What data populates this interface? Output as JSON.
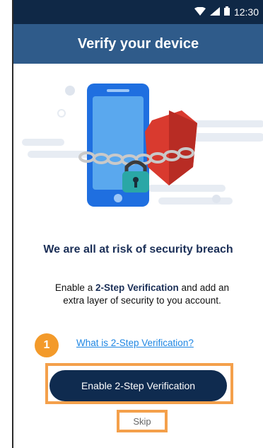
{
  "status_bar": {
    "time": "12:30",
    "icons": [
      "wifi-icon",
      "signal-icon",
      "battery-icon"
    ]
  },
  "app_bar": {
    "title": "Verify your device"
  },
  "illustration": {
    "name": "phone-chain-lock-shield"
  },
  "content": {
    "headline": "We are all at risk of security breach",
    "desc_prefix": "Enable a ",
    "desc_bold": "2-Step Verification",
    "desc_suffix": " and add an extra layer of security to you account."
  },
  "help_link": {
    "label": "What is 2-Step Verification?"
  },
  "badge": {
    "label": "1"
  },
  "actions": {
    "enable_label": "Enable 2-Step Verification",
    "skip_label": "Skip"
  },
  "colors": {
    "status_bar": "#0f2846",
    "app_bar": "#2f5b8a",
    "primary_button": "#0f2b4f",
    "link": "#1e86e3",
    "highlight": "#f4a04b",
    "badge": "#f39a2a"
  }
}
